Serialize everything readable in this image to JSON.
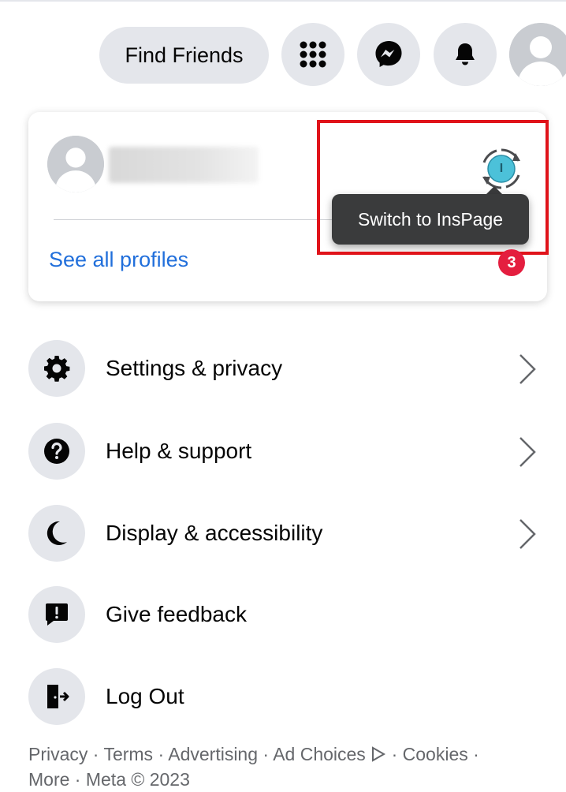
{
  "header": {
    "find_friends_label": "Find Friends",
    "buttons": [
      {
        "icon": "menu-grid-icon"
      },
      {
        "icon": "messenger-icon"
      },
      {
        "icon": "bell-icon"
      }
    ],
    "avatar_icon": "user-avatar-icon"
  },
  "profile_card": {
    "see_all_label": "See all profiles",
    "switch_tooltip": "Switch to InsPage",
    "switch_icon_letter": "I",
    "notification_count": "3"
  },
  "menu": {
    "items": [
      {
        "label": "Settings & privacy",
        "icon": "gear-icon",
        "has_chevron": true
      },
      {
        "label": "Help & support",
        "icon": "question-icon",
        "has_chevron": true
      },
      {
        "label": "Display & accessibility",
        "icon": "moon-icon",
        "has_chevron": true
      },
      {
        "label": "Give feedback",
        "icon": "feedback-icon",
        "has_chevron": false
      },
      {
        "label": "Log Out",
        "icon": "logout-icon",
        "has_chevron": false
      }
    ]
  },
  "footer": {
    "links": [
      "Privacy",
      "Terms",
      "Advertising",
      "Ad Choices",
      "Cookies",
      "More"
    ],
    "separator": " · ",
    "copyright": "Meta © 2023"
  },
  "colors": {
    "link_blue": "#216fdb",
    "badge_red": "#e41e3f",
    "highlight_red": "#e0131a",
    "tooltip_bg": "#3a3b3c",
    "button_gray": "#e4e6eb"
  }
}
